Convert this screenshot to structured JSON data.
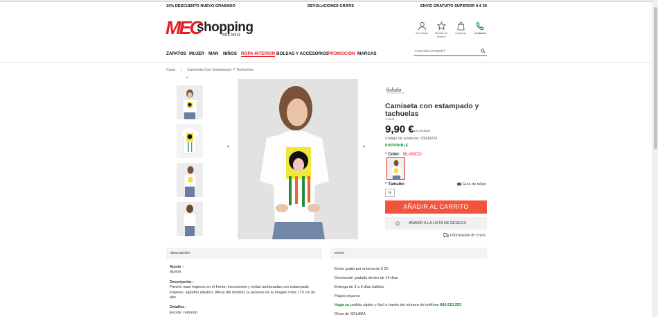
{
  "promo": {
    "left": "10% DESCUENTO NUEVO GRABADO",
    "center": "DEVOLUCIONES GRATIS",
    "right": "ENVÍO GRATUITO SUPERIOR A € 50"
  },
  "logo": {
    "mec": "MEC",
    "shopping": "shopping",
    "milano": "MILANO"
  },
  "user_icons": [
    {
      "label": "Mi cuenta",
      "icon": "user-icon"
    },
    {
      "label": "Mi lista de deseos",
      "icon": "star-icon"
    },
    {
      "label": "compras",
      "icon": "bag-icon"
    },
    {
      "label": "contacto",
      "icon": "phone-icon"
    }
  ],
  "nav": [
    {
      "label": "ZAPATOS"
    },
    {
      "label": "MUJER"
    },
    {
      "label": "MAN"
    },
    {
      "label": "NIÑOS"
    },
    {
      "label": "ROPA INTERIOR"
    },
    {
      "label": "BOLSAS Y ACCESORIOS"
    },
    {
      "label": "PROMOCIÓN"
    },
    {
      "label": "MARCAS"
    }
  ],
  "search": {
    "placeholder": "cosa stai cercando?"
  },
  "breadcrumb": {
    "home": "Casa",
    "separator": "|",
    "current": "Camiseta Con Estampado Y Tachuelas"
  },
  "product": {
    "brand_logo_text": "Solada",
    "title": "Camiseta con estampado y tachuelas",
    "vendor": "solada",
    "price": "9,90 €",
    "iva": "IVA incluido",
    "sku": "Código de producto: 00030225",
    "stock": "DISPONIBLE",
    "color_label": "Color:",
    "color_value": "BLANCO",
    "size_label": "Tamaño:",
    "size_value": "la",
    "size_guide": "Guía de tallas",
    "add_to_cart": "AÑADIR AL CARRITO",
    "add_to_wishlist": "AÑADIR A LA LISTA DE DESEOS",
    "shipping_info": "Información de envío",
    "required_marker": "*"
  },
  "panels": {
    "description_title": "descripción",
    "shipping_title": "envío"
  },
  "description": {
    "fit_label": "Ajuste :",
    "fit_value": "ajustar",
    "desc_label": "Descripción :",
    "desc_value": "Parche maxi impreso en el frente, inserciones y cintas tachonadas con estampado impreso. algodón elástico. Altura del modelo: la persona de la imagen mide 175 cm de alto",
    "details_label": "Detalles :",
    "details_value": "Escote: redondo"
  },
  "shipping": {
    "line1": "Envío gratis por encima de € 50",
    "line2": "Devolución gratuita dentro de 14 días",
    "line3": "Entrega de 3 a 5 días hábiles",
    "line4": "Pagos seguros",
    "line5_green": "Haga su",
    "line5_text": "pedido rápido y fácil a través del número de teléfono",
    "line5_phone": "800.515.253",
    "line6": "Otros de SOLADA"
  },
  "colors": {
    "accent": "#e31e24",
    "cart": "#f3543c",
    "green": "#0a8a2e"
  }
}
